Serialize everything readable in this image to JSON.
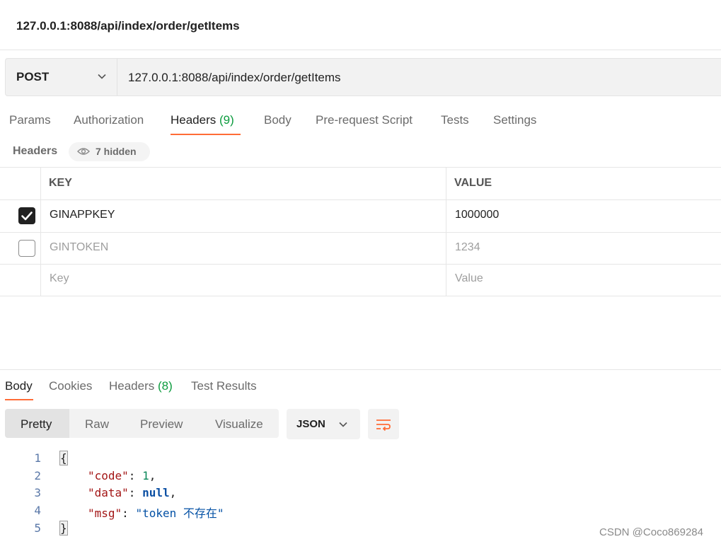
{
  "page_title": "127.0.0.1:8088/api/index/order/getItems",
  "request": {
    "method": "POST",
    "url": "127.0.0.1:8088/api/index/order/getItems"
  },
  "request_tabs": [
    {
      "label": "Params"
    },
    {
      "label": "Authorization"
    },
    {
      "label": "Headers",
      "count": "(9)"
    },
    {
      "label": "Body"
    },
    {
      "label": "Pre-request Script"
    },
    {
      "label": "Tests"
    },
    {
      "label": "Settings"
    }
  ],
  "headers_section": {
    "label": "Headers",
    "hidden_badge": "7 hidden"
  },
  "table": {
    "columns": [
      "KEY",
      "VALUE"
    ],
    "rows": [
      {
        "checked": true,
        "key": "GINAPPKEY",
        "value": "1000000"
      },
      {
        "checked": false,
        "key": "GINTOKEN",
        "value": "1234"
      }
    ],
    "new_row": {
      "key_placeholder": "Key",
      "value_placeholder": "Value"
    }
  },
  "response_tabs": [
    {
      "label": "Body"
    },
    {
      "label": "Cookies"
    },
    {
      "label": "Headers",
      "count": "(8)"
    },
    {
      "label": "Test Results"
    }
  ],
  "view_modes": [
    "Pretty",
    "Raw",
    "Preview",
    "Visualize"
  ],
  "format": "JSON",
  "code": {
    "line_numbers": [
      "1",
      "2",
      "3",
      "4",
      "5"
    ],
    "open_brace": "{",
    "close_brace": "}",
    "fields": [
      {
        "key": "\"code\"",
        "value": "1",
        "sep": ","
      },
      {
        "key": "\"data\"",
        "value": "null",
        "sep": ","
      },
      {
        "key": "\"msg\"",
        "value": "\"token 不存在\"",
        "sep": ""
      }
    ]
  },
  "watermark": "CSDN @Coco869284",
  "colors": {
    "accent": "#ff6c37",
    "count_green": "#0c9b3e"
  }
}
